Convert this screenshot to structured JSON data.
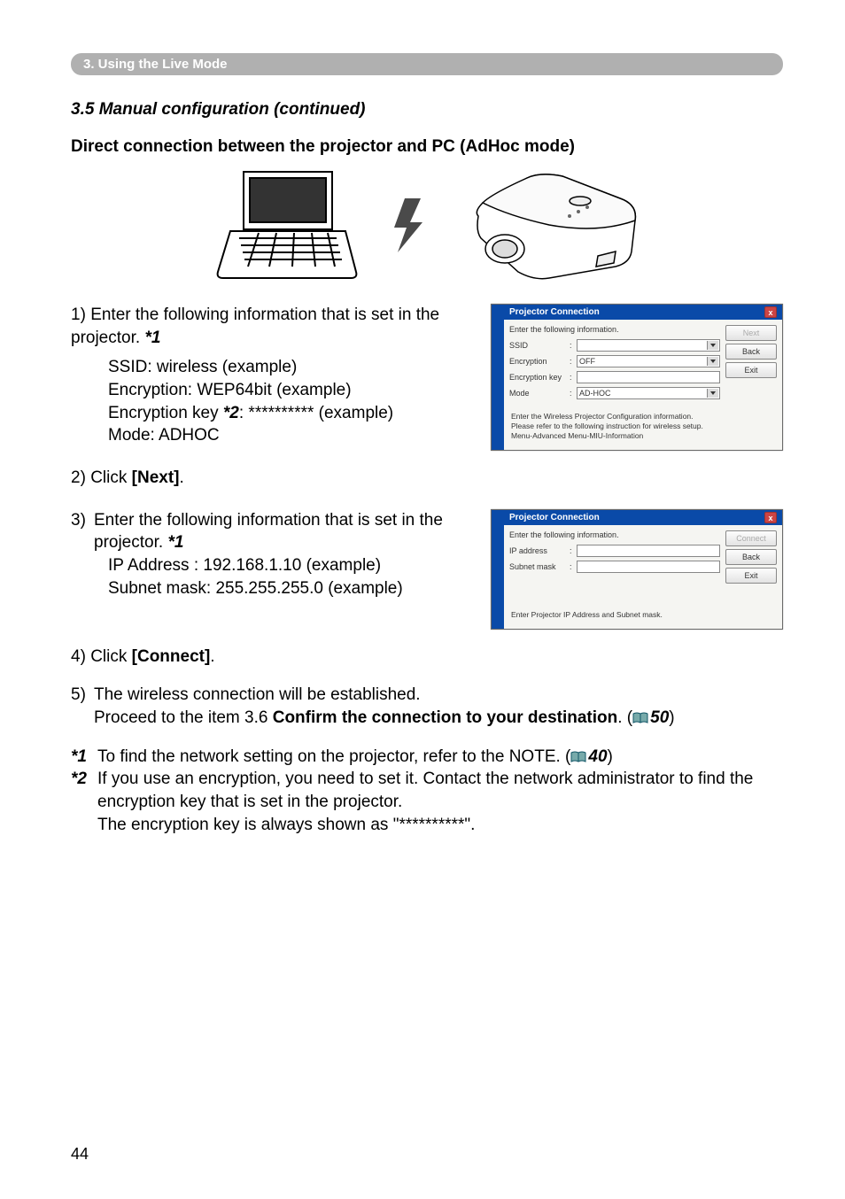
{
  "section_bar": "3. Using the Live Mode",
  "sub_heading": "3.5 Manual configuration (continued)",
  "sub_sub_heading": "Direct connection between the projector and PC (AdHoc mode)",
  "step1": {
    "num": "1)",
    "text_a": "Enter the following information that is set in the projector. ",
    "marker": "*1",
    "lines": {
      "ssid": "SSID: wireless (example)",
      "enc": "Encryption: WEP64bit (example)",
      "key_prefix": "Encryption key ",
      "key_marker": "*2",
      "key_suffix": ": ********** (example)",
      "mode": "Mode: ADHOC"
    }
  },
  "dialog1": {
    "title": "Projector Connection",
    "instr": "Enter the following information.",
    "fields": {
      "ssid_label": "SSID",
      "enc_label": "Encryption",
      "enc_value": "OFF",
      "key_label": "Encryption key",
      "mode_label": "Mode",
      "mode_value": "AD-HOC"
    },
    "buttons": {
      "next": "Next",
      "back": "Back",
      "exit": "Exit"
    },
    "footer": {
      "l1": "Enter the Wireless Projector Configuration information.",
      "l2": "Please refer to the following instruction for wireless setup.",
      "l3": "Menu-Advanced Menu-MIU-Information"
    }
  },
  "step2": {
    "num": "2)",
    "text_a": "Click ",
    "bold": "[Next]",
    "text_b": "."
  },
  "step3": {
    "num": "3)",
    "text_a": "Enter the following information that is set in the projector. ",
    "marker": "*1",
    "lines": {
      "ip": "IP Address : 192.168.1.10 (example)",
      "mask": "Subnet mask: 255.255.255.0 (example)"
    }
  },
  "dialog2": {
    "title": "Projector Connection",
    "instr": "Enter the following information.",
    "fields": {
      "ip_label": "IP address",
      "mask_label": "Subnet mask"
    },
    "buttons": {
      "connect": "Connect",
      "back": "Back",
      "exit": "Exit"
    },
    "footer": {
      "l1": "Enter Projector IP Address and Subnet mask."
    }
  },
  "step4": {
    "num": "4)",
    "text_a": "Click ",
    "bold": "[Connect]",
    "text_b": "."
  },
  "step5": {
    "num": "5)",
    "l1": "The wireless connection will be established.",
    "l2_a": "Proceed to the item 3.6 ",
    "l2_bold": "Confirm the connection to your destination",
    "l2_b": ". (",
    "l2_ref": "50",
    "l2_c": ")"
  },
  "fn1": {
    "num": "*1",
    "text_a": " To find the network setting on the projector, refer to the NOTE. (",
    "ref": "40",
    "text_b": ")"
  },
  "fn2": {
    "num": "*2",
    "l1": " If you use an encryption, you need to set it.  Contact the network administrator to find the encryption key that is set in the projector.",
    "l2": "The encryption key is always shown as \"**********\"."
  },
  "page_number": "44"
}
